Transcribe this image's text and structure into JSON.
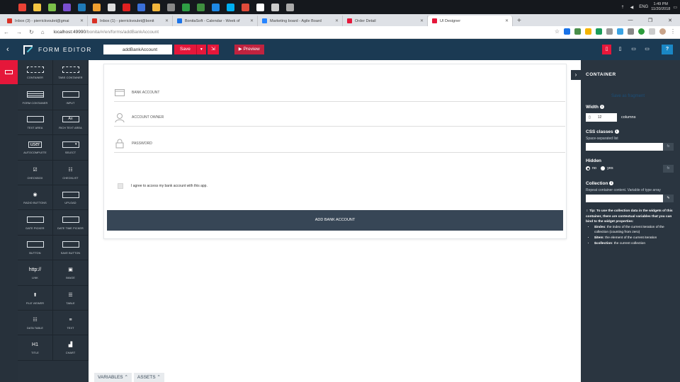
{
  "taskbar": {
    "icons": [
      {
        "name": "windows-start-icon",
        "color": "#15181d"
      },
      {
        "name": "chrome-icon",
        "color": "#e94235"
      },
      {
        "name": "file-explorer-icon",
        "color": "#f4c542"
      },
      {
        "name": "app-icon",
        "color": "#7cbf4a"
      },
      {
        "name": "app-icon",
        "color": "#7a4fd1"
      },
      {
        "name": "app-icon",
        "color": "#1f7ab8"
      },
      {
        "name": "app-icon",
        "color": "#f0a030"
      },
      {
        "name": "app-icon",
        "color": "#ddd"
      },
      {
        "name": "acrobat-icon",
        "color": "#e02020"
      },
      {
        "name": "app-icon",
        "color": "#3a6fd8"
      },
      {
        "name": "app-icon",
        "color": "#f2b63c"
      },
      {
        "name": "app-icon",
        "color": "#888"
      },
      {
        "name": "app-icon",
        "color": "#2e9e44"
      },
      {
        "name": "app-icon",
        "color": "#3f8f3f"
      },
      {
        "name": "uipath-icon",
        "color": "#1e88e5"
      },
      {
        "name": "skype-icon",
        "color": "#00aff0"
      },
      {
        "name": "app-icon",
        "color": "#e04b3a"
      },
      {
        "name": "app-icon",
        "color": "#fff"
      },
      {
        "name": "app-icon",
        "color": "#ccc"
      },
      {
        "name": "app-icon",
        "color": "#aaa"
      }
    ],
    "lang": "ENG",
    "time": "1:49 PM",
    "date": "11/20/2018"
  },
  "tabs": [
    {
      "label": "Inbox (3) - pierrickvoulet@gmai",
      "color": "#d93025",
      "active": false
    },
    {
      "label": "Inbox (1) - pierrickvoulet@bonit",
      "color": "#d93025",
      "active": false
    },
    {
      "label": "BonitaSoft - Calendar - Week of",
      "color": "#1a73e8",
      "active": false
    },
    {
      "label": "Marketing board - Agile Board",
      "color": "#2684ff",
      "active": false
    },
    {
      "label": "Order Detail",
      "color": "#e5173a",
      "active": false
    },
    {
      "label": "UI Designer",
      "color": "#e5173a",
      "active": true
    }
  ],
  "new_tab": "+",
  "address": {
    "host": "localhost:49990",
    "path": "/bonita/#/en/forms/addBankAccount"
  },
  "app": {
    "brand": "FORM EDITOR",
    "form_name": "addBankAccount",
    "save": "Save",
    "preview": "▶ Preview",
    "help": "?"
  },
  "palette": [
    {
      "label": "Container",
      "icon": "dash"
    },
    {
      "label": "Tabs container",
      "icon": "dash"
    },
    {
      "label": "Form container",
      "icon": "form"
    },
    {
      "label": "Input",
      "icon": "box"
    },
    {
      "label": "Text area",
      "icon": "box"
    },
    {
      "label": "Rich text area",
      "icon": "rich"
    },
    {
      "label": "Autocomplete",
      "icon": "text:user"
    },
    {
      "label": "Select",
      "icon": "select"
    },
    {
      "label": "Checkbox",
      "icon": "text:☑"
    },
    {
      "label": "Checklist",
      "icon": "text:☷"
    },
    {
      "label": "Radio buttons",
      "icon": "text:◉"
    },
    {
      "label": "Upload",
      "icon": "box"
    },
    {
      "label": "Date picker",
      "icon": "box"
    },
    {
      "label": "Date time picker",
      "icon": "box"
    },
    {
      "label": "Button",
      "icon": "box"
    },
    {
      "label": "Save button",
      "icon": "box"
    },
    {
      "label": "Link",
      "icon": "text:http://"
    },
    {
      "label": "Image",
      "icon": "text:▣"
    },
    {
      "label": "File viewer",
      "icon": "text:⬆"
    },
    {
      "label": "Table",
      "icon": "text:☰"
    },
    {
      "label": "Data table",
      "icon": "text:☷"
    },
    {
      "label": "Text",
      "icon": "text:≡"
    },
    {
      "label": "Title",
      "icon": "text:H1"
    },
    {
      "label": "Chart",
      "icon": "text:▟"
    }
  ],
  "form": {
    "fields": [
      {
        "label": "BANK ACCOUNT",
        "icon": "card"
      },
      {
        "label": "ACCOUNT OWNER",
        "icon": "user"
      },
      {
        "label": "PASSWORD",
        "icon": "lock"
      }
    ],
    "checkbox_label": "I agree to access my bank account with this app.",
    "submit_label": "ADD BANK ACCOUNT"
  },
  "drawer": {
    "variables": "VARIABLES ⌃",
    "assets": "ASSETS ⌃"
  },
  "properties": {
    "title": "CONTAINER",
    "save_as_fragment": "Save as fragment",
    "width_label": "Width",
    "width_value": "12",
    "width_unit": "columns",
    "css_label": "CSS classes",
    "css_hint": "Space-separated list",
    "hidden_label": "Hidden",
    "hidden_no": "no",
    "hidden_yes": "yes",
    "collection_label": "Collection",
    "collection_hint": "Repeat container content. Variable of type array",
    "tip_intro": "Tip: To use the collection data in the widgets of this container, there are contextual variables that you can bind to the widget properties:",
    "tip_items": [
      {
        "key": "$index",
        "text": ": the index of the current iteration of the collection (counting from zero)"
      },
      {
        "key": "$item",
        "text": ": the element of the current iteration"
      },
      {
        "key": "$collection",
        "text": ": the current collection"
      }
    ],
    "fx": "fx"
  }
}
